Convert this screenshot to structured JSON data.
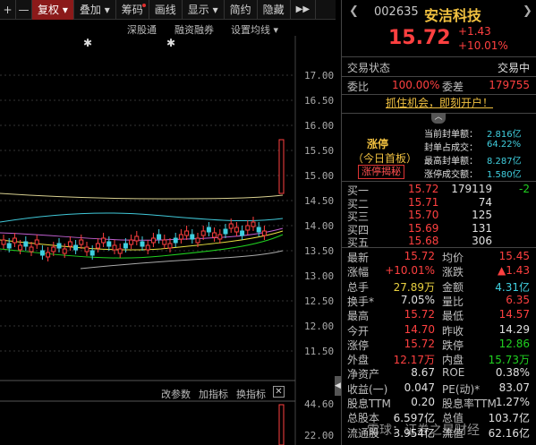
{
  "toolbar": {
    "plus": "+",
    "minus": "—",
    "adj": "复权",
    "overlay": "叠加",
    "chips": "筹码",
    "draw": "画线",
    "display": "显示",
    "simple": "简约",
    "hide": "隐藏",
    "more": "▶▶"
  },
  "chart_tools": {
    "deep": "深股通",
    "margin": "融资融券",
    "ma_setting": "设置均线"
  },
  "indicator_tools": {
    "params": "改参数",
    "add": "加指标",
    "switch": "换指标"
  },
  "y_axis": [
    "17.00",
    "16.50",
    "16.00",
    "15.50",
    "15.00",
    "14.50",
    "14.00",
    "13.50",
    "13.00",
    "12.50",
    "12.00",
    "11.50"
  ],
  "y_axis_lower": [
    "44.60",
    "22.00"
  ],
  "stock": {
    "code": "002635",
    "name": "安洁科技",
    "price": "15.72",
    "change": "+1.43",
    "change_pct": "+10.01%"
  },
  "status": {
    "label": "交易状态",
    "value": "交易中"
  },
  "ratio": {
    "wb_label": "委比",
    "wb_value": "100.00%",
    "wc_label": "委差",
    "wc_value": "179755"
  },
  "promo": "抓住机会，即刻开户！",
  "limit": {
    "title": "涨停",
    "sub": "（今日首板）",
    "reveal": "涨停揭秘",
    "rows": [
      {
        "label": "当前封单额：",
        "value": "2.816亿"
      },
      {
        "label": "封单占成交：",
        "value": "64.22%"
      },
      {
        "label": "最高封单额：",
        "value": "8.287亿"
      },
      {
        "label": "涨停成交额：",
        "value": "1.580亿"
      }
    ]
  },
  "buys": [
    {
      "label": "买一",
      "price": "15.72",
      "vol": "179119",
      "diff": "-2"
    },
    {
      "label": "买二",
      "price": "15.71",
      "vol": "74",
      "diff": ""
    },
    {
      "label": "买三",
      "price": "15.70",
      "vol": "125",
      "diff": ""
    },
    {
      "label": "买四",
      "price": "15.69",
      "vol": "131",
      "diff": ""
    },
    {
      "label": "买五",
      "price": "15.68",
      "vol": "306",
      "diff": ""
    }
  ],
  "quotes": [
    {
      "l1": "最新",
      "v1": "15.72",
      "c1": "red",
      "l2": "均价",
      "v2": "15.45",
      "c2": "red"
    },
    {
      "l1": "涨幅",
      "v1": "+10.01%",
      "c1": "red",
      "l2": "涨跌",
      "v2": "▲1.43",
      "c2": "red"
    },
    {
      "l1": "总手",
      "v1": "27.89万",
      "c1": "yellow",
      "l2": "金额",
      "v2": "4.31亿",
      "c2": "cyan"
    },
    {
      "l1": "换手*",
      "v1": "7.05%",
      "c1": "white",
      "l2": "量比",
      "v2": "6.35",
      "c2": "red"
    },
    {
      "l1": "最高",
      "v1": "15.72",
      "c1": "red",
      "l2": "最低",
      "v2": "14.57",
      "c2": "red"
    },
    {
      "l1": "今开",
      "v1": "14.70",
      "c1": "red",
      "l2": "昨收",
      "v2": "14.29",
      "c2": "white"
    },
    {
      "l1": "涨停",
      "v1": "15.72",
      "c1": "red",
      "l2": "跌停",
      "v2": "12.86",
      "c2": "green"
    },
    {
      "l1": "外盘",
      "v1": "12.17万",
      "c1": "red",
      "l2": "内盘",
      "v2": "15.73万",
      "c2": "green"
    },
    {
      "l1": "净资产",
      "v1": "8.67",
      "c1": "white",
      "l2": "ROE",
      "v2": "0.38%",
      "c2": "white"
    },
    {
      "l1": "收益(一)",
      "v1": "0.047",
      "c1": "white",
      "l2": "PE(动)*",
      "v2": "83.07",
      "c2": "white"
    },
    {
      "l1": "股息TTM",
      "v1": "0.20",
      "c1": "white",
      "l2": "股息率TTM",
      "v2": "1.27%",
      "c2": "white"
    },
    {
      "l1": "总股本",
      "v1": "6.597亿",
      "c1": "white",
      "l2": "总值",
      "v2": "103.7亿",
      "c2": "white"
    },
    {
      "l1": "流通股",
      "v1": "3.954亿",
      "c1": "white",
      "l2": "流值",
      "v2": "62.16亿",
      "c2": "white"
    }
  ],
  "watermark": "雪球：证券之星财经",
  "colors": {
    "up": "#ff4040",
    "down": "#20d020",
    "accent": "#f0c040"
  }
}
